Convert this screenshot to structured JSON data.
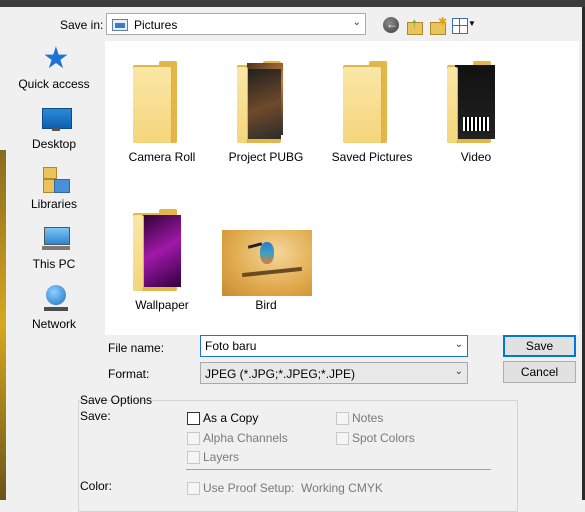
{
  "save_in": {
    "label": "Save in:",
    "value": "Pictures"
  },
  "places": [
    {
      "label": "Quick access"
    },
    {
      "label": "Desktop"
    },
    {
      "label": "Libraries"
    },
    {
      "label": "This PC"
    },
    {
      "label": "Network"
    }
  ],
  "files": [
    {
      "name": "Camera Roll",
      "type": "folder"
    },
    {
      "name": "Project PUBG",
      "type": "folder"
    },
    {
      "name": "Saved Pictures",
      "type": "folder"
    },
    {
      "name": "Video",
      "type": "folder"
    },
    {
      "name": "Wallpaper",
      "type": "folder"
    },
    {
      "name": "Bird",
      "type": "image"
    }
  ],
  "file_name": {
    "label": "File name:",
    "value": "Foto baru"
  },
  "format": {
    "label": "Format:",
    "value": "JPEG (*.JPG;*.JPEG;*.JPE)"
  },
  "buttons": {
    "save": "Save",
    "cancel": "Cancel"
  },
  "save_options": {
    "title": "Save Options",
    "save_label": "Save:",
    "as_a_copy": "As a Copy",
    "notes": "Notes",
    "alpha_channels": "Alpha Channels",
    "spot_colors": "Spot Colors",
    "layers": "Layers",
    "color_label": "Color:",
    "use_proof_setup": "Use Proof Setup:  Working CMYK"
  }
}
